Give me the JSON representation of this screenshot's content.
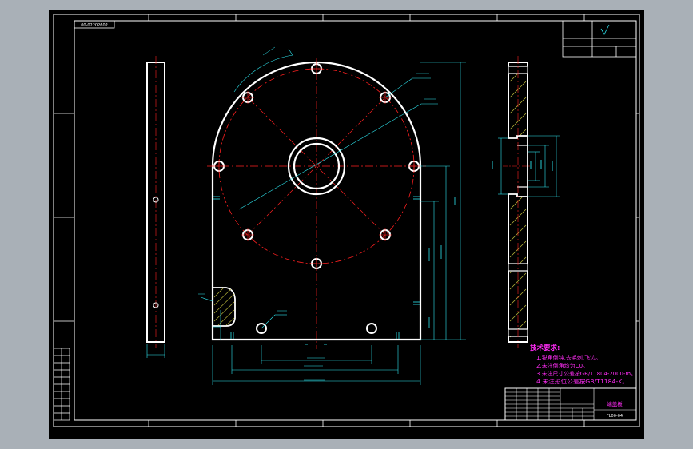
{
  "title_block": {
    "part_code": "FL00-04",
    "part_name": "端盖板"
  },
  "header_tag": "00-02202602",
  "tech_requirements": {
    "title": "技术要求:",
    "items": [
      "1.锐角倒钝,去毛刺,飞边。",
      "2.未注倒角均为C0。",
      "3.未注尺寸公差按GB/T1804-2000-m。",
      "4.未注形位公差按GB/T1184-K。"
    ]
  },
  "colors": {
    "background": "#000000",
    "frame": "#ffffff",
    "dimension": "#2ee6f0",
    "centerline": "#ff2020",
    "note": "#ff2cf5",
    "hatch": "#b9b63a"
  }
}
